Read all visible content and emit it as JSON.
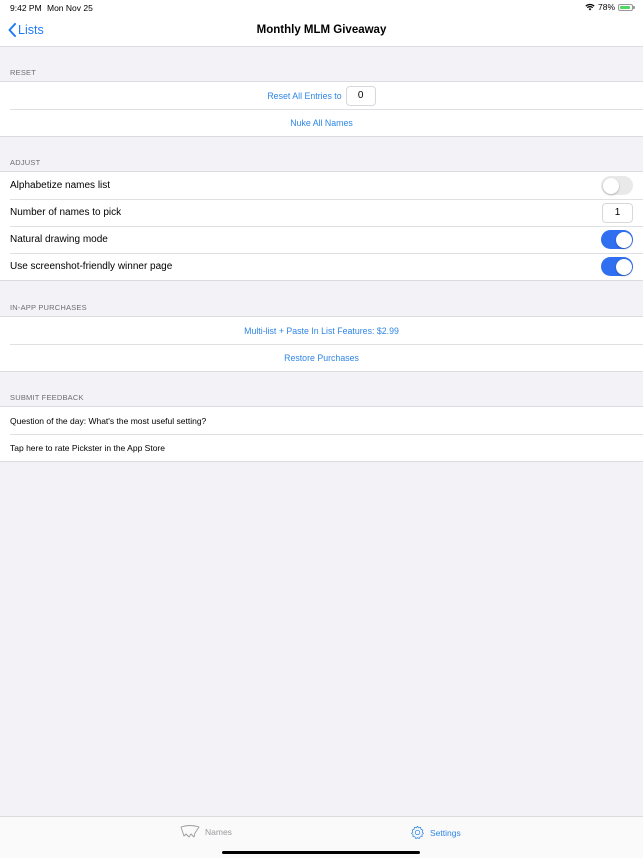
{
  "status_bar": {
    "time": "9:42 PM",
    "date": "Mon Nov 25",
    "wifi_icon": "wifi-icon",
    "battery_percent": "78%",
    "battery_level": 0.78,
    "battery_charging": true
  },
  "nav": {
    "back_label": "Lists",
    "title": "Monthly MLM Giveaway"
  },
  "sections": {
    "reset": {
      "header": "RESET",
      "reset_entries_label": "Reset All Entries to",
      "reset_entries_value": "0",
      "nuke_label": "Nuke All Names"
    },
    "adjust": {
      "header": "ADJUST",
      "alphabetize_label": "Alphabetize names list",
      "alphabetize_on": false,
      "number_label": "Number of names to pick",
      "number_value": "1",
      "natural_label": "Natural drawing mode",
      "natural_on": true,
      "screenshot_label": "Use screenshot-friendly winner page",
      "screenshot_on": true
    },
    "purchases": {
      "header": "IN-APP PURCHASES",
      "multilist_label": "Multi-list + Paste In List Features: $2.99",
      "restore_label": "Restore Purchases"
    },
    "feedback": {
      "header": "SUBMIT FEEDBACK",
      "question_label": "Question of the day: What's the most useful setting?",
      "rate_label": "Tap here to rate Pickster in the App Store"
    }
  },
  "tab_bar": {
    "tabs": [
      {
        "label": "Names",
        "icon": "hat-icon",
        "selected": false
      },
      {
        "label": "Settings",
        "icon": "gear-icon",
        "selected": true
      }
    ]
  },
  "colors": {
    "accent": "#2f86e6",
    "toggle_on": "#2f6ff0",
    "background": "#f2f2f7"
  }
}
